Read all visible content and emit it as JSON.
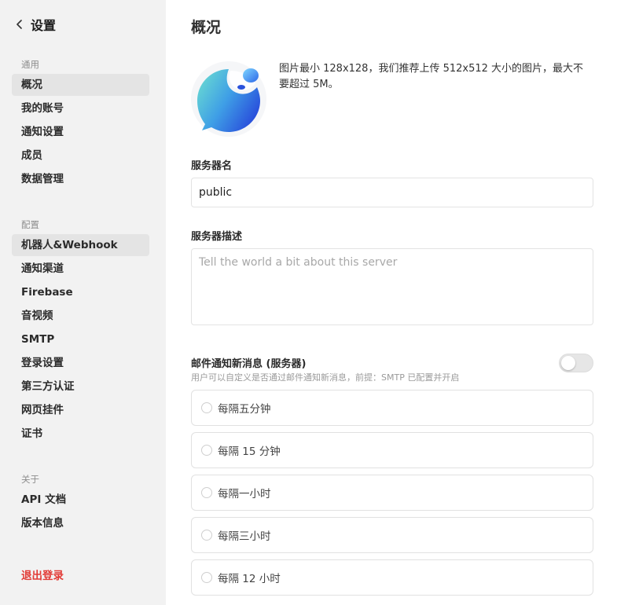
{
  "sidebar": {
    "back_title": "设置",
    "sections": [
      {
        "label": "通用",
        "items": [
          "概况",
          "我的账号",
          "通知设置",
          "成员",
          "数据管理"
        ]
      },
      {
        "label": "配置",
        "items": [
          "机器人&Webhook",
          "通知渠道",
          "Firebase",
          "音视频",
          "SMTP",
          "登录设置",
          "第三方认证",
          "网页挂件",
          "证书"
        ]
      },
      {
        "label": "关于",
        "items": [
          "API 文档",
          "版本信息"
        ]
      }
    ],
    "active_item": "概况",
    "hovered_item": "机器人&Webhook",
    "logout_label": "退出登录"
  },
  "main": {
    "title": "概况",
    "avatar_hint": "图片最小 128x128，我们推荐上传 512x512 大小的图片，最大不要超过 5M。",
    "server_name_label": "服务器名",
    "server_name_value": "public",
    "server_desc_label": "服务器描述",
    "server_desc_placeholder": "Tell the world a bit about this server",
    "email_notify_title": "邮件通知新消息 (服务器)",
    "email_notify_desc": "用户可以自定义是否通过邮件通知新消息，前提：SMTP 已配置并开启",
    "email_notify_enabled": false,
    "frequency_options": [
      "每隔五分钟",
      "每隔 15 分钟",
      "每隔一小时",
      "每隔三小时",
      "每隔 12 小时"
    ]
  },
  "colors": {
    "sidebar_bg": "#f2f2f2",
    "active_item_bg": "#e4e4e4",
    "logout": "#e23b36",
    "avatar_gradient_start": "#6fe0d0",
    "avatar_gradient_end": "#2f5fe0"
  }
}
